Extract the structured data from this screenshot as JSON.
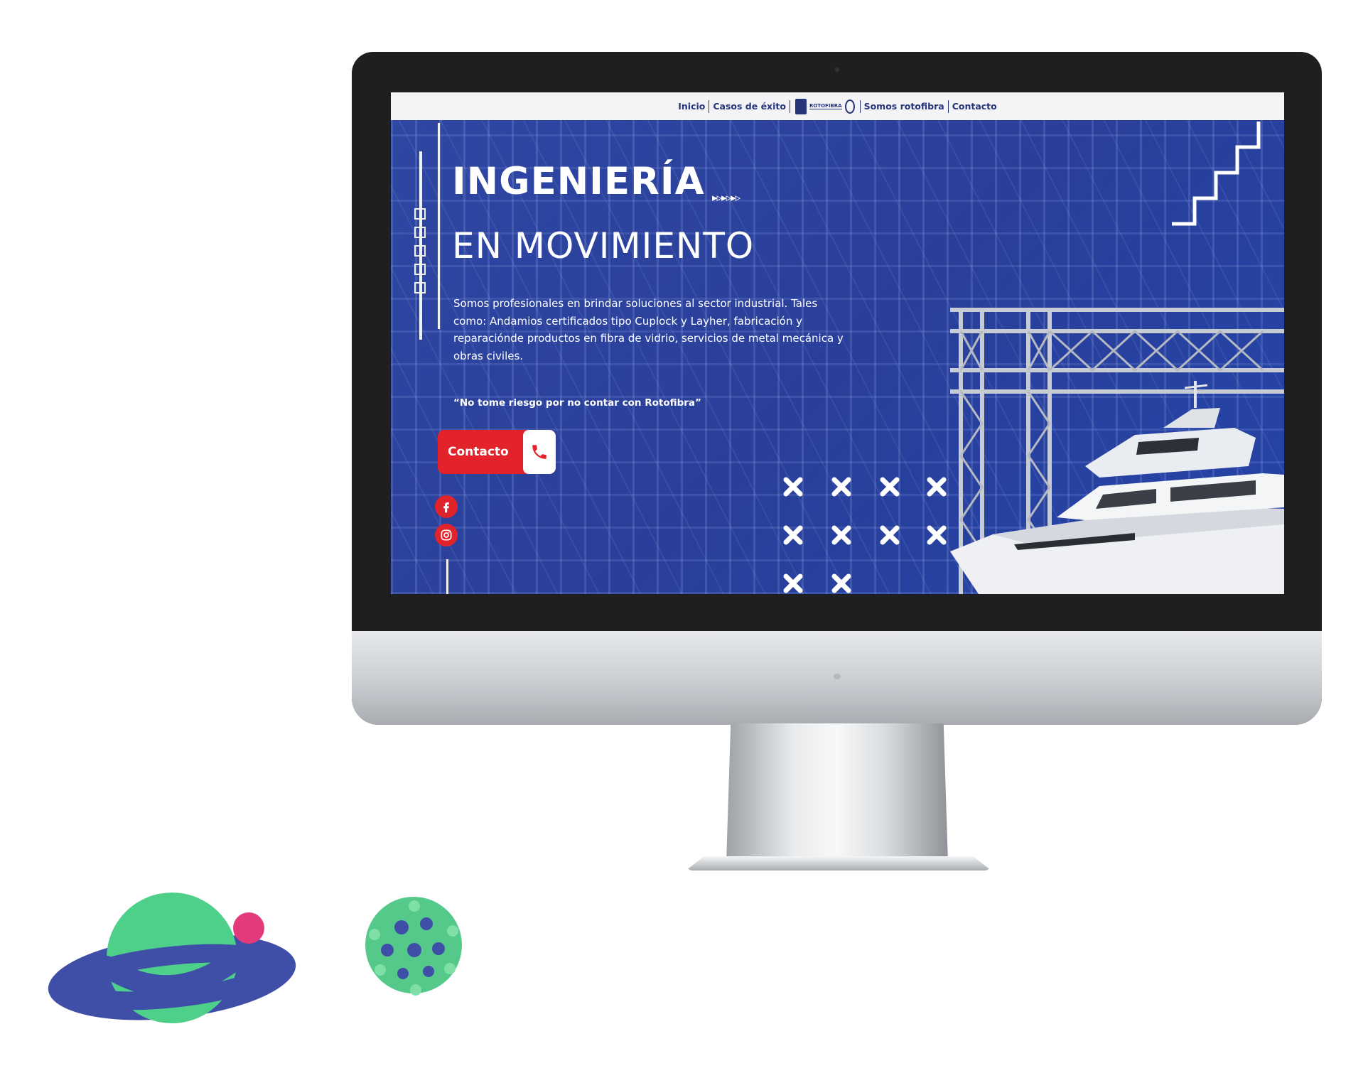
{
  "nav": {
    "items": [
      {
        "label": "Inicio"
      },
      {
        "label": "Casos de éxito"
      },
      {
        "label": "Somos rotofibra"
      },
      {
        "label": "Contacto"
      }
    ],
    "logo_text": "ROTOFIBRA"
  },
  "hero": {
    "headline": "INGENIERÍA",
    "arrows": "▸▹▸▹▸▹",
    "subheadline": "EN MOVIMIENTO",
    "description": "Somos profesionales en brindar soluciones al sector industrial. Tales como: Andamios certificados tipo Cuplock y Layher, fabricación y reparaciónde productos en fibra de vidrio, servicios de metal mecánica y obras civiles.",
    "quote": "“No tome riesgo por no contar con Rotofibra”",
    "cta_label": "Contacto"
  },
  "icons": {
    "phone": "phone-icon",
    "facebook": "facebook-icon",
    "instagram": "instagram-icon"
  },
  "colors": {
    "hero_blue": "#27409b",
    "accent_red": "#e2232b",
    "nav_text": "#26347a",
    "planet_green": "#4fd08a",
    "planet_ring": "#3f4fa8",
    "moon_pink": "#e23a7a"
  }
}
